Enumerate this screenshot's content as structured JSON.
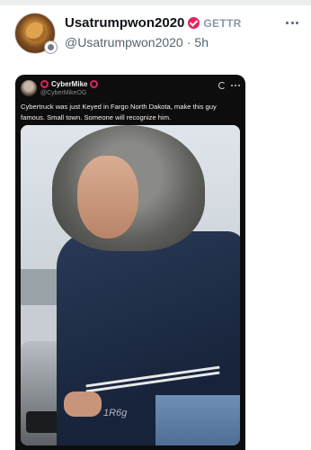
{
  "post": {
    "display_name": "Usatrumpwon2020",
    "badge_label": "GETTR",
    "handle": "@Usatrumpwon2020",
    "separator": "·",
    "time": "5h"
  },
  "embedded": {
    "name": "CyberMike",
    "handle": "@CyberMikeOG",
    "text": "Cybertruck was just Keyed in Fargo North Dakota, make this guy famous. Small town. Someone will recognize him.",
    "image_alt": "Photo of a young man in a fur-trimmed hood and dark blue jacket standing next to a car",
    "watermark": "1R6g"
  },
  "colors": {
    "verified_badge": "#e0245e",
    "card_bg": "#0d0d0d",
    "muted_text": "#536471"
  }
}
